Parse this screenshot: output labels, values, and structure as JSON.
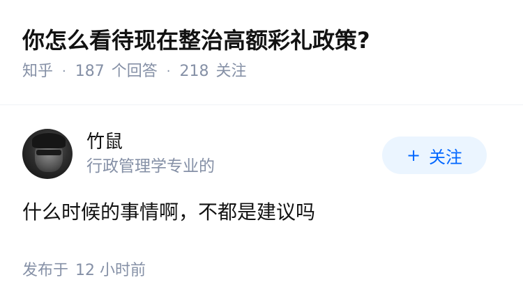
{
  "question": {
    "title": "你怎么看待现在整治高额彩礼政策?",
    "source": "知乎",
    "answer_count": "187",
    "answer_label": "个回答",
    "follower_count": "218",
    "follower_label": "关注"
  },
  "answer": {
    "author_name": "竹鼠",
    "author_bio": "行政管理学专业的",
    "follow_button_label": "关注",
    "follow_icon": "plus-icon",
    "content": "什么时候的事情啊，不都是建议吗",
    "published_label": "发布于",
    "published_time": "12 小时前"
  },
  "colors": {
    "primary_text": "#121212",
    "secondary_text": "#8590a6",
    "accent_blue": "#0066ff",
    "follow_button_bg": "#ebf5ff",
    "divider": "#f0f2f7"
  }
}
